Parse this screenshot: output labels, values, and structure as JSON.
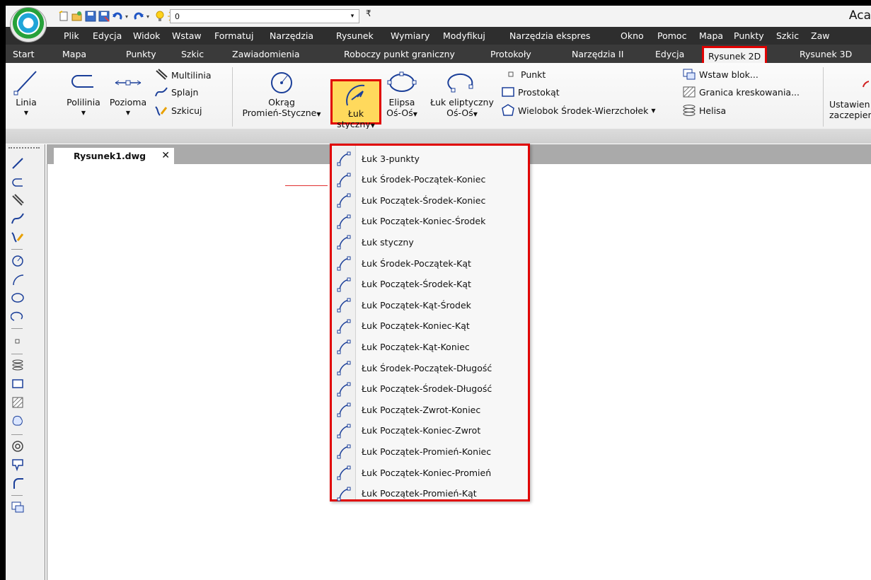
{
  "app": {
    "title": "Aca",
    "quick_access": {
      "layer_value": "0",
      "more": "₹"
    }
  },
  "menu": [
    "Plik",
    "Edycja",
    "Widok",
    "Wstaw",
    "Formatuj",
    "Narzędzia",
    "Rysunek",
    "Wymiary",
    "Modyfikuj",
    "Narzędzia ekspres",
    "Okno",
    "Pomoc",
    "Mapa",
    "Punkty",
    "Szkic",
    "Zaw"
  ],
  "tabs": [
    "Start",
    "Mapa",
    "Punkty",
    "Szkic",
    "Zawiadomienia",
    "Roboczy punkt graniczny",
    "Protokoły",
    "Narzędzia II",
    "Edycja",
    "Rysunek 2D",
    "Rysunek 3D"
  ],
  "active_tab": "Rysunek 2D",
  "ribbon": {
    "linia": "Linia",
    "polilinia": "Polilinia",
    "pozioma": "Pozioma",
    "multilinia": "Multilinia",
    "splajn": "Splajn",
    "szkicuj": "Szkicuj",
    "okrag_line1": "Okrąg",
    "okrag_line2": "Promień-Styczne",
    "luk_line1": "Łuk",
    "luk_line2": "styczny",
    "elipsa_line1": "Elipsa",
    "elipsa_line2": "Oś-Oś",
    "luk_elipt_line1": "Łuk eliptyczny",
    "luk_elipt_line2": "Oś-Oś",
    "punkt": "Punkt",
    "prostokat": "Prostokąt",
    "wielobok": "Wielobok Środek-Wierzchołek",
    "wstaw_blok": "Wstaw blok...",
    "granica": "Granica kreskowania...",
    "helisa": "Helisa",
    "ustawienia_line1": "Ustawien",
    "ustawienia_line2": "zaczepien"
  },
  "document": {
    "tab_name": "Rysunek1.dwg",
    "close_glyph": "✕"
  },
  "arc_menu": [
    "Łuk 3-punkty",
    "Łuk Środek-Początek-Koniec",
    "Łuk Początek-Środek-Koniec",
    "Łuk Początek-Koniec-Środek",
    "Łuk styczny",
    "Łuk Środek-Początek-Kąt",
    "Łuk Początek-Środek-Kąt",
    "Łuk Początek-Kąt-Środek",
    "Łuk Początek-Koniec-Kąt",
    "Łuk Początek-Kąt-Koniec",
    "Łuk Środek-Początek-Długość",
    "Łuk Początek-Środek-Długość",
    "Łuk Początek-Zwrot-Koniec",
    "Łuk Początek-Koniec-Zwrot",
    "Łuk Początek-Promień-Koniec",
    "Łuk Początek-Koniec-Promień",
    "Łuk Początek-Promień-Kąt"
  ],
  "colors": {
    "highlight": "#e00000",
    "menubar_bg": "#2e2e2e",
    "active_tool_bg": "#ffd95c"
  }
}
